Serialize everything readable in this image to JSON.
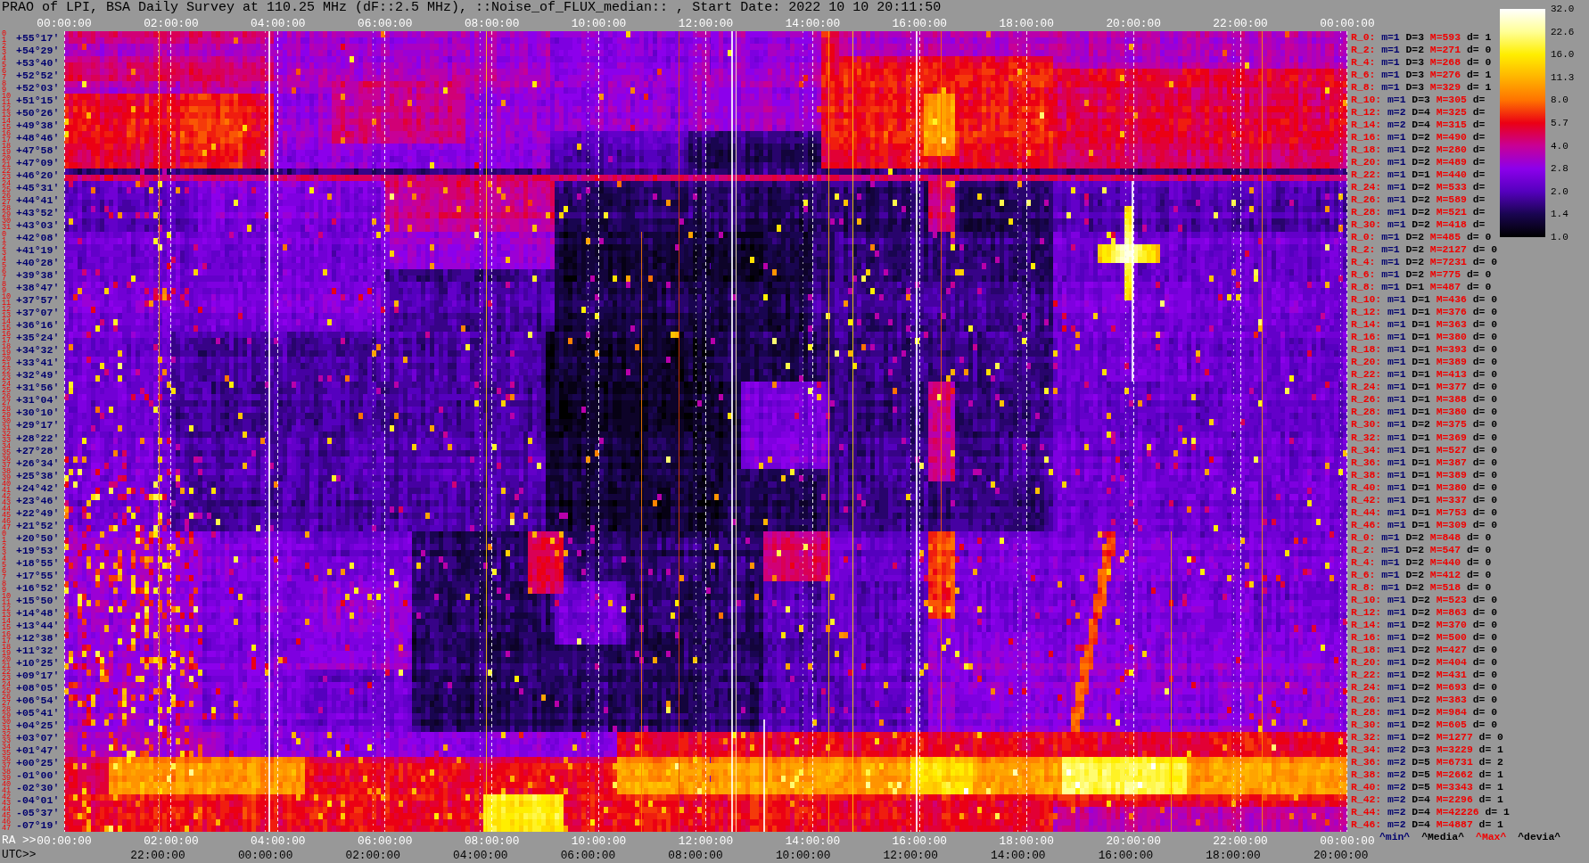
{
  "title": "PRAO of LPI, BSA Daily Survey at 110.25 MHz (dF::2.5 MHz), ::Noise_of_FLUX_median:: , Start Date: 2022 10 10 20:11:50",
  "top_axis": {
    "labels": [
      "00:00:00",
      "02:00:00",
      "04:00:00",
      "06:00:00",
      "08:00:00",
      "10:00:00",
      "12:00:00",
      "14:00:00",
      "16:00:00",
      "18:00:00",
      "20:00:00",
      "22:00:00",
      "00:00:00"
    ]
  },
  "colorbar": {
    "labels": [
      "32.0",
      "22.6",
      "16.0",
      "11.3",
      "8.0",
      "5.7",
      "4.0",
      "2.8",
      "2.0",
      "1.4",
      "1.0"
    ]
  },
  "rows": [
    {
      "beams": [
        "0",
        "1"
      ],
      "dec": "+55°17′",
      "stats": {
        "label": "R_0:",
        "min": "m=1",
        "median": "D=3",
        "max": "M=593",
        "devia": "d= 1"
      }
    },
    {
      "beams": [
        "2",
        "3"
      ],
      "dec": "+54°29′",
      "stats": {
        "label": "R_2:",
        "min": "m=1",
        "median": "D=2",
        "max": "M=271",
        "devia": "d= 0"
      }
    },
    {
      "beams": [
        "4",
        "5"
      ],
      "dec": "+53°40′",
      "stats": {
        "label": "R_4:",
        "min": "m=1",
        "median": "D=3",
        "max": "M=268",
        "devia": "d= 0"
      }
    },
    {
      "beams": [
        "6",
        "7"
      ],
      "dec": "+52°52′",
      "stats": {
        "label": "R_6:",
        "min": "m=1",
        "median": "D=3",
        "max": "M=276",
        "devia": "d= 1"
      }
    },
    {
      "beams": [
        "8",
        "9"
      ],
      "dec": "+52°03′",
      "stats": {
        "label": "R_8:",
        "min": "m=1",
        "median": "D=3",
        "max": "M=329",
        "devia": "d= 1"
      }
    },
    {
      "beams": [
        "10",
        "11"
      ],
      "dec": "+51°15′",
      "stats": {
        "label": "R_10:",
        "min": "m=1",
        "median": "D=3",
        "max": "M=305",
        "devia": "d="
      }
    },
    {
      "beams": [
        "12",
        "13"
      ],
      "dec": "+50°26′",
      "stats": {
        "label": "R_12:",
        "min": "m=2",
        "median": "D=4",
        "max": "M=325",
        "devia": "d="
      }
    },
    {
      "beams": [
        "14",
        "15"
      ],
      "dec": "+49°38′",
      "stats": {
        "label": "R_14:",
        "min": "m=2",
        "median": "D=4",
        "max": "M=315",
        "devia": "d="
      }
    },
    {
      "beams": [
        "16",
        "17"
      ],
      "dec": "+48°46′",
      "stats": {
        "label": "R_16:",
        "min": "m=1",
        "median": "D=2",
        "max": "M=490",
        "devia": "d="
      }
    },
    {
      "beams": [
        "18",
        "19"
      ],
      "dec": "+47°58′",
      "stats": {
        "label": "R_18:",
        "min": "m=1",
        "median": "D=2",
        "max": "M=280",
        "devia": "d="
      }
    },
    {
      "beams": [
        "20",
        "21"
      ],
      "dec": "+47°09′",
      "stats": {
        "label": "R_20:",
        "min": "m=1",
        "median": "D=2",
        "max": "M=489",
        "devia": "d="
      }
    },
    {
      "beams": [
        "22",
        "23"
      ],
      "dec": "+46°20′",
      "stats": {
        "label": "R_22:",
        "min": "m=1",
        "median": "D=1",
        "max": "M=440",
        "devia": "d="
      }
    },
    {
      "beams": [
        "24",
        "25"
      ],
      "dec": "+45°31′",
      "stats": {
        "label": "R_24:",
        "min": "m=1",
        "median": "D=2",
        "max": "M=533",
        "devia": "d="
      }
    },
    {
      "beams": [
        "26",
        "27"
      ],
      "dec": "+44°41′",
      "stats": {
        "label": "R_26:",
        "min": "m=1",
        "median": "D=2",
        "max": "M=589",
        "devia": "d="
      }
    },
    {
      "beams": [
        "28",
        "29"
      ],
      "dec": "+43°52′",
      "stats": {
        "label": "R_28:",
        "min": "m=1",
        "median": "D=2",
        "max": "M=521",
        "devia": "d="
      }
    },
    {
      "beams": [
        "30",
        "31"
      ],
      "dec": "+43°03′",
      "stats": {
        "label": "R_30:",
        "min": "m=1",
        "median": "D=2",
        "max": "M=418",
        "devia": "d="
      }
    },
    {
      "beams": [
        "0",
        "1"
      ],
      "dec": "+42°08′",
      "stats": {
        "label": "R_0:",
        "min": "m=1",
        "median": "D=2",
        "max": "M=485",
        "devia": "d= 0"
      }
    },
    {
      "beams": [
        "2",
        "3"
      ],
      "dec": "+41°19′",
      "stats": {
        "label": "R_2:",
        "min": "m=1",
        "median": "D=2",
        "max": "M=2127",
        "devia": "d= 0"
      }
    },
    {
      "beams": [
        "4",
        "5"
      ],
      "dec": "+40°28′",
      "stats": {
        "label": "R_4:",
        "min": "m=1",
        "median": "D=2",
        "max": "M=7231",
        "devia": "d= 0"
      }
    },
    {
      "beams": [
        "6",
        "7"
      ],
      "dec": "+39°38′",
      "stats": {
        "label": "R_6:",
        "min": "m=1",
        "median": "D=2",
        "max": "M=775",
        "devia": "d= 0"
      }
    },
    {
      "beams": [
        "8",
        "9"
      ],
      "dec": "+38°47′",
      "stats": {
        "label": "R_8:",
        "min": "m=1",
        "median": "D=1",
        "max": "M=487",
        "devia": "d= 0"
      }
    },
    {
      "beams": [
        "10",
        "11"
      ],
      "dec": "+37°57′",
      "stats": {
        "label": "R_10:",
        "min": "m=1",
        "median": "D=1",
        "max": "M=436",
        "devia": "d= 0"
      }
    },
    {
      "beams": [
        "12",
        "13"
      ],
      "dec": "+37°07′",
      "stats": {
        "label": "R_12:",
        "min": "m=1",
        "median": "D=1",
        "max": "M=376",
        "devia": "d= 0"
      }
    },
    {
      "beams": [
        "14",
        "15"
      ],
      "dec": "+36°16′",
      "stats": {
        "label": "R_14:",
        "min": "m=1",
        "median": "D=1",
        "max": "M=363",
        "devia": "d= 0"
      }
    },
    {
      "beams": [
        "16",
        "17"
      ],
      "dec": "+35°24′",
      "stats": {
        "label": "R_16:",
        "min": "m=1",
        "median": "D=1",
        "max": "M=380",
        "devia": "d= 0"
      }
    },
    {
      "beams": [
        "18",
        "19"
      ],
      "dec": "+34°32′",
      "stats": {
        "label": "R_18:",
        "min": "m=1",
        "median": "D=1",
        "max": "M=393",
        "devia": "d= 0"
      }
    },
    {
      "beams": [
        "20",
        "21"
      ],
      "dec": "+33°41′",
      "stats": {
        "label": "R_20:",
        "min": "m=1",
        "median": "D=1",
        "max": "M=389",
        "devia": "d= 0"
      }
    },
    {
      "beams": [
        "22",
        "23"
      ],
      "dec": "+32°49′",
      "stats": {
        "label": "R_22:",
        "min": "m=1",
        "median": "D=1",
        "max": "M=413",
        "devia": "d= 0"
      }
    },
    {
      "beams": [
        "24",
        "25"
      ],
      "dec": "+31°56′",
      "stats": {
        "label": "R_24:",
        "min": "m=1",
        "median": "D=1",
        "max": "M=377",
        "devia": "d= 0"
      }
    },
    {
      "beams": [
        "26",
        "27"
      ],
      "dec": "+31°04′",
      "stats": {
        "label": "R_26:",
        "min": "m=1",
        "median": "D=1",
        "max": "M=388",
        "devia": "d= 0"
      }
    },
    {
      "beams": [
        "28",
        "29"
      ],
      "dec": "+30°10′",
      "stats": {
        "label": "R_28:",
        "min": "m=1",
        "median": "D=1",
        "max": "M=380",
        "devia": "d= 0"
      }
    },
    {
      "beams": [
        "30",
        "31"
      ],
      "dec": "+29°17′",
      "stats": {
        "label": "R_30:",
        "min": "m=1",
        "median": "D=2",
        "max": "M=375",
        "devia": "d= 0"
      }
    },
    {
      "beams": [
        "32",
        "33"
      ],
      "dec": "+28°22′",
      "stats": {
        "label": "R_32:",
        "min": "m=1",
        "median": "D=1",
        "max": "M=369",
        "devia": "d= 0"
      }
    },
    {
      "beams": [
        "34",
        "35"
      ],
      "dec": "+27°28′",
      "stats": {
        "label": "R_34:",
        "min": "m=1",
        "median": "D=1",
        "max": "M=527",
        "devia": "d= 0"
      }
    },
    {
      "beams": [
        "36",
        "37"
      ],
      "dec": "+26°34′",
      "stats": {
        "label": "R_36:",
        "min": "m=1",
        "median": "D=1",
        "max": "M=387",
        "devia": "d= 0"
      }
    },
    {
      "beams": [
        "38",
        "39"
      ],
      "dec": "+25°38′",
      "stats": {
        "label": "R_38:",
        "min": "m=1",
        "median": "D=1",
        "max": "M=389",
        "devia": "d= 0"
      }
    },
    {
      "beams": [
        "40",
        "41"
      ],
      "dec": "+24°42′",
      "stats": {
        "label": "R_40:",
        "min": "m=1",
        "median": "D=1",
        "max": "M=380",
        "devia": "d= 0"
      }
    },
    {
      "beams": [
        "42",
        "43"
      ],
      "dec": "+23°46′",
      "stats": {
        "label": "R_42:",
        "min": "m=1",
        "median": "D=1",
        "max": "M=337",
        "devia": "d= 0"
      }
    },
    {
      "beams": [
        "44",
        "45"
      ],
      "dec": "+22°49′",
      "stats": {
        "label": "R_44:",
        "min": "m=1",
        "median": "D=1",
        "max": "M=753",
        "devia": "d= 0"
      }
    },
    {
      "beams": [
        "46",
        "47"
      ],
      "dec": "+21°52′",
      "stats": {
        "label": "R_46:",
        "min": "m=1",
        "median": "D=1",
        "max": "M=309",
        "devia": "d= 0"
      }
    },
    {
      "beams": [
        "0",
        "1"
      ],
      "dec": "+20°50′",
      "stats": {
        "label": "R_0:",
        "min": "m=1",
        "median": "D=2",
        "max": "M=848",
        "devia": "d= 0"
      }
    },
    {
      "beams": [
        "2",
        "3"
      ],
      "dec": "+19°53′",
      "stats": {
        "label": "R_2:",
        "min": "m=1",
        "median": "D=2",
        "max": "M=547",
        "devia": "d= 0"
      }
    },
    {
      "beams": [
        "4",
        "5"
      ],
      "dec": "+18°55′",
      "stats": {
        "label": "R_4:",
        "min": "m=1",
        "median": "D=2",
        "max": "M=440",
        "devia": "d= 0"
      }
    },
    {
      "beams": [
        "6",
        "7"
      ],
      "dec": "+17°55′",
      "stats": {
        "label": "R_6:",
        "min": "m=1",
        "median": "D=2",
        "max": "M=412",
        "devia": "d= 0"
      }
    },
    {
      "beams": [
        "8",
        "9"
      ],
      "dec": "+16°52′",
      "stats": {
        "label": "R_8:",
        "min": "m=1",
        "median": "D=2",
        "max": "M=518",
        "devia": "d= 0"
      }
    },
    {
      "beams": [
        "10",
        "11"
      ],
      "dec": "+15°50′",
      "stats": {
        "label": "R_10:",
        "min": "m=1",
        "median": "D=2",
        "max": "M=523",
        "devia": "d= 0"
      }
    },
    {
      "beams": [
        "12",
        "13"
      ],
      "dec": "+14°48′",
      "stats": {
        "label": "R_12:",
        "min": "m=1",
        "median": "D=2",
        "max": "M=863",
        "devia": "d= 0"
      }
    },
    {
      "beams": [
        "14",
        "15"
      ],
      "dec": "+13°44′",
      "stats": {
        "label": "R_14:",
        "min": "m=1",
        "median": "D=2",
        "max": "M=370",
        "devia": "d= 0"
      }
    },
    {
      "beams": [
        "16",
        "17"
      ],
      "dec": "+12°38′",
      "stats": {
        "label": "R_16:",
        "min": "m=1",
        "median": "D=2",
        "max": "M=500",
        "devia": "d= 0"
      }
    },
    {
      "beams": [
        "18",
        "19"
      ],
      "dec": "+11°32′",
      "stats": {
        "label": "R_18:",
        "min": "m=1",
        "median": "D=2",
        "max": "M=427",
        "devia": "d= 0"
      }
    },
    {
      "beams": [
        "20",
        "21"
      ],
      "dec": "+10°25′",
      "stats": {
        "label": "R_20:",
        "min": "m=1",
        "median": "D=2",
        "max": "M=404",
        "devia": "d= 0"
      }
    },
    {
      "beams": [
        "22",
        "23"
      ],
      "dec": "+09°17′",
      "stats": {
        "label": "R_22:",
        "min": "m=1",
        "median": "D=2",
        "max": "M=431",
        "devia": "d= 0"
      }
    },
    {
      "beams": [
        "24",
        "25"
      ],
      "dec": "+08°05′",
      "stats": {
        "label": "R_24:",
        "min": "m=1",
        "median": "D=2",
        "max": "M=693",
        "devia": "d= 0"
      }
    },
    {
      "beams": [
        "26",
        "27"
      ],
      "dec": "+06°54′",
      "stats": {
        "label": "R_26:",
        "min": "m=1",
        "median": "D=2",
        "max": "M=383",
        "devia": "d= 0"
      }
    },
    {
      "beams": [
        "28",
        "29"
      ],
      "dec": "+05°41′",
      "stats": {
        "label": "R_28:",
        "min": "m=1",
        "median": "D=2",
        "max": "M=984",
        "devia": "d= 0"
      }
    },
    {
      "beams": [
        "30",
        "31"
      ],
      "dec": "+04°25′",
      "stats": {
        "label": "R_30:",
        "min": "m=1",
        "median": "D=2",
        "max": "M=605",
        "devia": "d= 0"
      }
    },
    {
      "beams": [
        "32",
        "33"
      ],
      "dec": "+03°07′",
      "stats": {
        "label": "R_32:",
        "min": "m=1",
        "median": "D=2",
        "max": "M=1277",
        "devia": "d= 0"
      }
    },
    {
      "beams": [
        "34",
        "35"
      ],
      "dec": "+01°47′",
      "stats": {
        "label": "R_34:",
        "min": "m=2",
        "median": "D=3",
        "max": "M=3229",
        "devia": "d= 1"
      }
    },
    {
      "beams": [
        "36",
        "37"
      ],
      "dec": "+00°25′",
      "stats": {
        "label": "R_36:",
        "min": "m=2",
        "median": "D=5",
        "max": "M=6731",
        "devia": "d= 2"
      }
    },
    {
      "beams": [
        "38",
        "39"
      ],
      "dec": "-01°00′",
      "stats": {
        "label": "R_38:",
        "min": "m=2",
        "median": "D=5",
        "max": "M=2662",
        "devia": "d= 1"
      }
    },
    {
      "beams": [
        "40",
        "41"
      ],
      "dec": "-02°30′",
      "stats": {
        "label": "R_40:",
        "min": "m=2",
        "median": "D=5",
        "max": "M=3343",
        "devia": "d= 1"
      }
    },
    {
      "beams": [
        "42",
        "43"
      ],
      "dec": "-04°01′",
      "stats": {
        "label": "R_42:",
        "min": "m=2",
        "median": "D=4",
        "max": "M=2296",
        "devia": "d= 1"
      }
    },
    {
      "beams": [
        "44",
        "45"
      ],
      "dec": "-05°37′",
      "stats": {
        "label": "R_44:",
        "min": "m=2",
        "median": "D=4",
        "max": "M=42226",
        "devia": "d= 1"
      }
    },
    {
      "beams": [
        "46",
        "47"
      ],
      "dec": "-07°19′",
      "stats": {
        "label": "R_46:",
        "min": "m=2",
        "median": "D=4",
        "max": "M=4887",
        "devia": "d= 1"
      }
    }
  ],
  "bottom_axis": {
    "ra_prefix": "RA >>",
    "ra_labels": [
      "00:00:00",
      "02:00:00",
      "04:00:00",
      "06:00:00",
      "08:00:00",
      "10:00:00",
      "12:00:00",
      "14:00:00",
      "16:00:00",
      "18:00:00",
      "20:00:00",
      "22:00:00",
      "00:00:00"
    ],
    "utc_prefix": "UTC>>",
    "utc_labels": [
      "22:00:00",
      "00:00:00",
      "02:00:00",
      "04:00:00",
      "06:00:00",
      "08:00:00",
      "10:00:00",
      "12:00:00",
      "14:00:00",
      "16:00:00",
      "18:00:00",
      "20:00:00"
    ]
  },
  "legend": {
    "min": "^min^",
    "median": "^Media^",
    "max": "^Max^",
    "devia": "^devia^"
  }
}
